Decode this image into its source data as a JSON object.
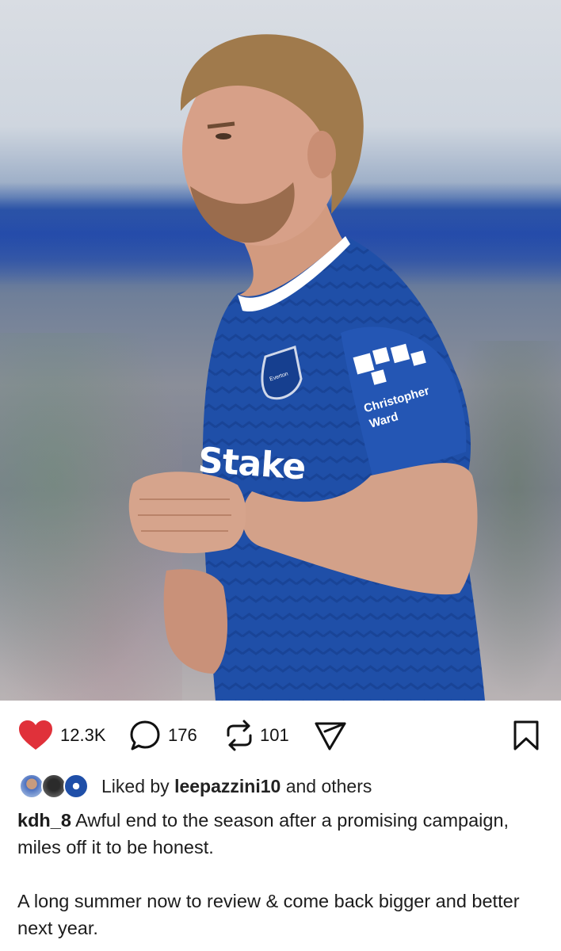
{
  "post": {
    "username": "kdh_8",
    "caption_line1": "Awful end to the season after a promising campaign, miles off it to be honest.",
    "caption_line2": "A long summer now to review & come back bigger and better next year."
  },
  "actions": {
    "likes": "12.3K",
    "comments": "176",
    "reposts": "101"
  },
  "liked_by": {
    "prefix": "Liked by",
    "user": "leepazzini10",
    "suffix": "and others"
  },
  "photo": {
    "shirt_sponsor": "Stake",
    "sleeve_sponsor_line1": "Christopher",
    "sleeve_sponsor_line2": "Ward",
    "crest_text": "Everton"
  },
  "colors": {
    "like": "#e0313a",
    "kit_blue": "#1f4fa8"
  },
  "icons": {
    "like": "heart-icon",
    "comment": "comment-icon",
    "repost": "repost-icon",
    "share": "share-icon",
    "save": "bookmark-icon"
  }
}
